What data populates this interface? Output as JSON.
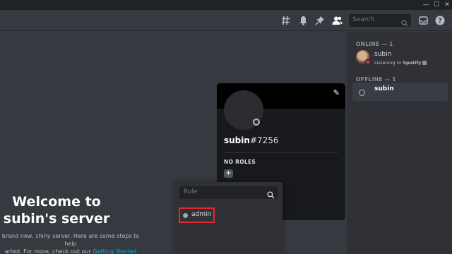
{
  "window": {
    "minimize": "—",
    "maximize": "☐",
    "close": "✕"
  },
  "header": {
    "icons": [
      "threads-icon",
      "bell-icon",
      "pin-icon",
      "members-icon",
      "inbox-icon",
      "help-icon"
    ],
    "search_placeholder": "Search"
  },
  "welcome": {
    "title_line1": "Welcome to",
    "title_line2": "subin's server",
    "desc_line1": "brand new, shiny server. Here are some steps to help",
    "desc_line2": "arted. For more, check out our ",
    "desc_link": "Getting Started guide",
    "desc_end": "."
  },
  "members": {
    "online_header": "ONLINE — 1",
    "offline_header": "OFFLINE — 1",
    "online": [
      {
        "name": "subin",
        "activity_prefix": "Listening to ",
        "activity": "Spotify",
        "status": "dnd"
      }
    ],
    "offline": [
      {
        "name": "subin"
      }
    ]
  },
  "profile": {
    "username": "subin",
    "tag": "#7256",
    "roles_header": "NO ROLES",
    "add_role": "+"
  },
  "role_menu": {
    "placeholder": "Role",
    "roles": [
      {
        "name": "admin",
        "color": "#99aab5"
      }
    ]
  },
  "colors": {
    "background": "#36393f",
    "sidebar": "#2f3136",
    "popout": "#18191c",
    "link": "#00aff4",
    "highlight_border": "#e0282e",
    "dnd": "#ed4245"
  }
}
